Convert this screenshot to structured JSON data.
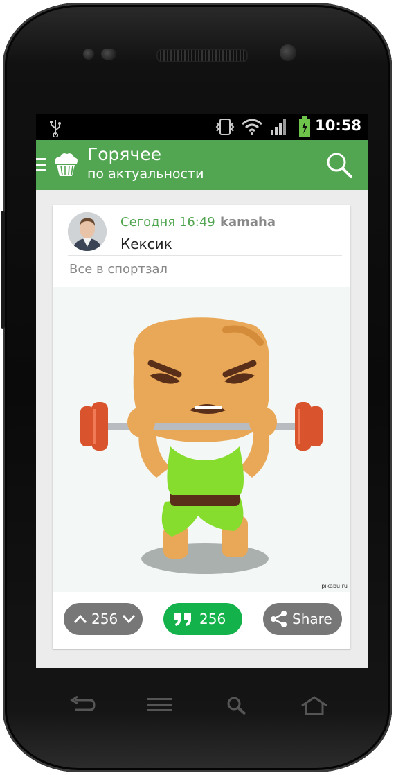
{
  "status_bar": {
    "time": "10:58"
  },
  "app_bar": {
    "title": "Горячее",
    "subtitle": "по актуальности"
  },
  "post": {
    "date": "Сегодня 16:49",
    "author": "kamaha",
    "title": "Кексик",
    "tags": "Все в спортзал",
    "watermark": "pikabu.ru",
    "rating": "256",
    "comments": "256",
    "share_label": "Share"
  },
  "colors": {
    "accent": "#52a652",
    "comments_button": "#14b24b",
    "button_gray": "#777777"
  },
  "icons": {
    "status": [
      "usb-icon",
      "vibrate-icon",
      "wifi-icon",
      "signal-icon",
      "battery-icon"
    ],
    "app_bar": [
      "menu-icon",
      "cupcake-logo-icon",
      "search-icon"
    ],
    "nav": [
      "back-icon",
      "menu-icon",
      "search-icon",
      "home-icon"
    ]
  }
}
